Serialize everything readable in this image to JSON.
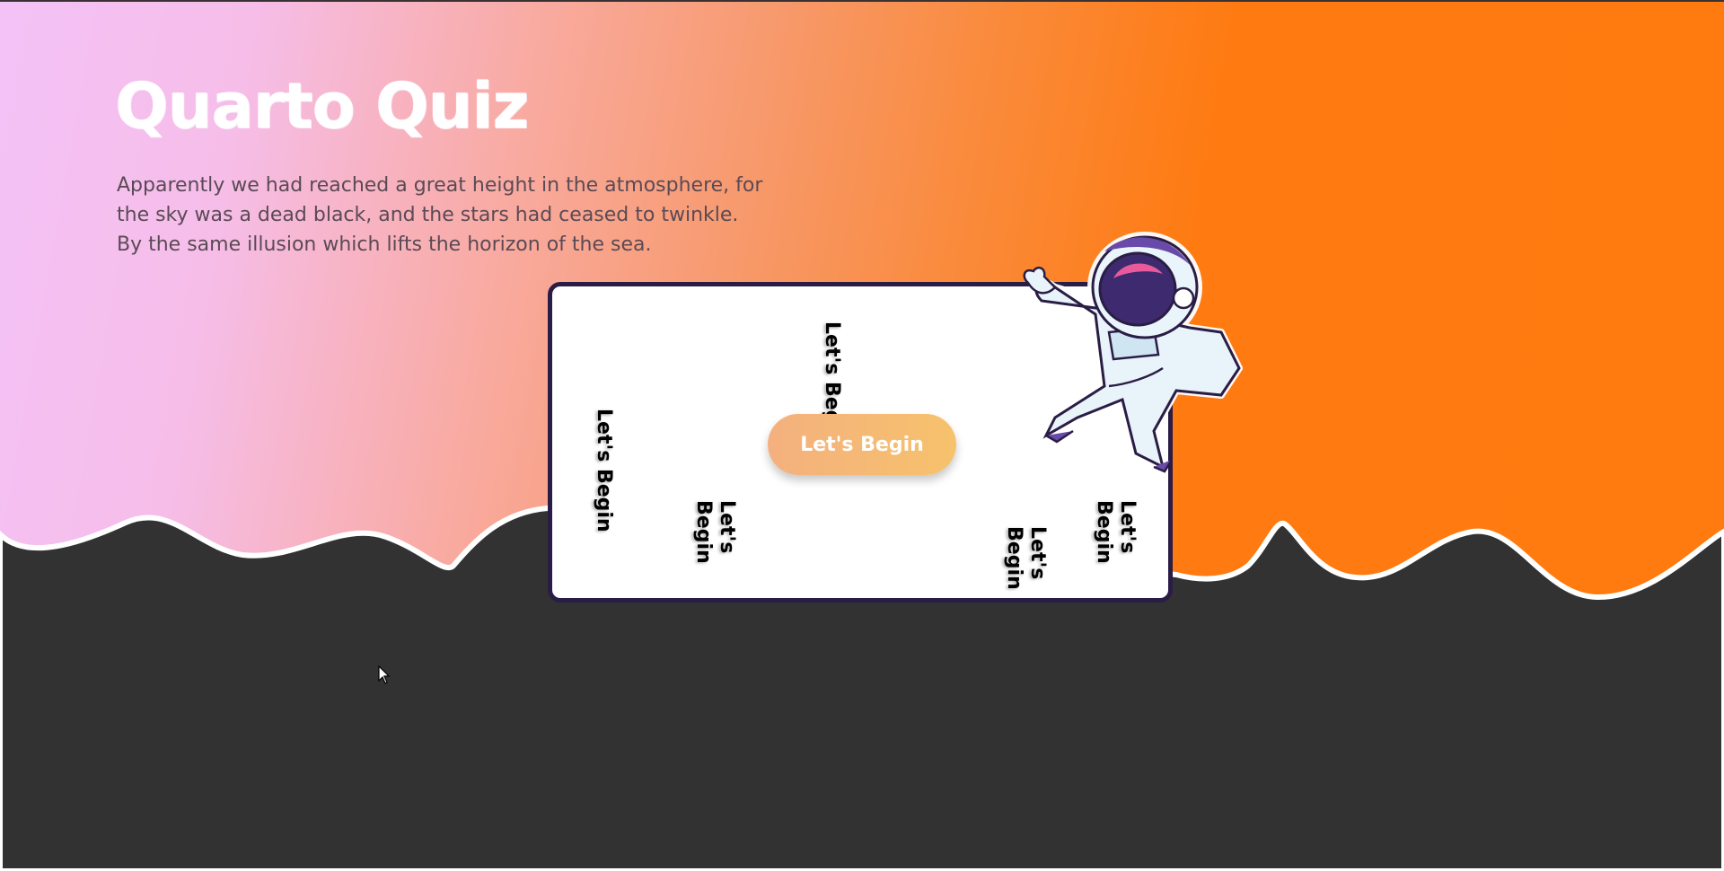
{
  "hero": {
    "title": "Quarto Quiz",
    "description": "Apparently we had reached a great height in the atmosphere, for the sky was a dead black, and the stars had ceased to twinkle. By the same illusion which lifts the horizon of the sea."
  },
  "card": {
    "start_button_label": "Let's Begin",
    "floating_labels": [
      "Let's Begin",
      "Let's Begin",
      "Let's\nBegin",
      "Let's\nBegin",
      "Let's\nBegin"
    ]
  },
  "icons": {
    "astronaut": "astronaut-illustration",
    "cursor": "mouse-pointer-icon"
  },
  "colors": {
    "gradient_start": "#f4c2f7",
    "gradient_end": "#ff7a0f",
    "ground": "#333233",
    "card_border": "#2a1d45",
    "button_start": "#f4b07e",
    "button_end": "#f6c26c"
  }
}
